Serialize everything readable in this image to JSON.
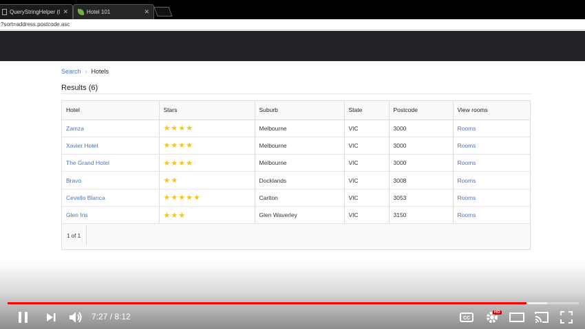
{
  "browser": {
    "tabs": [
      {
        "title": "QueryStringHelper (thym",
        "active": false
      },
      {
        "title": "Hotel 101",
        "active": true
      }
    ],
    "url": "?sort=address.postcode.asc"
  },
  "breadcrumb": {
    "link": "Search",
    "separator": "›",
    "current": "Hotels"
  },
  "results_title": "Results (6)",
  "table": {
    "headers": [
      "Hotel",
      "Stars",
      "Suburb",
      "State",
      "Postcode",
      "View rooms"
    ],
    "rows": [
      {
        "hotel": "Zamza",
        "stars": 4,
        "suburb": "Melbourne",
        "state": "VIC",
        "postcode": "3000",
        "link": "Rooms"
      },
      {
        "hotel": "Xavier Hotel",
        "stars": 4,
        "suburb": "Melbourne",
        "state": "VIC",
        "postcode": "3000",
        "link": "Rooms"
      },
      {
        "hotel": "The Grand Hotel",
        "stars": 4,
        "suburb": "Melbourne",
        "state": "VIC",
        "postcode": "3000",
        "link": "Rooms"
      },
      {
        "hotel": "Bravo",
        "stars": 2,
        "suburb": "Docklands",
        "state": "VIC",
        "postcode": "3008",
        "link": "Rooms"
      },
      {
        "hotel": "Cevello Blanca",
        "stars": 5,
        "suburb": "Carlton",
        "state": "VIC",
        "postcode": "3053",
        "link": "Rooms"
      },
      {
        "hotel": "Glen Iris",
        "stars": 3,
        "suburb": "Glen Waverley",
        "state": "VIC",
        "postcode": "3150",
        "link": "Rooms"
      }
    ]
  },
  "pager": "1 of 1",
  "player": {
    "time": "7:27 / 8:12",
    "played_fraction": 0.908,
    "buffered_fraction": 0.945,
    "hd_label": "HD",
    "progress_color": "#ff0000"
  },
  "colors": {
    "link": "#4a76b8",
    "star": "#f5c518",
    "navbar": "#222326"
  }
}
